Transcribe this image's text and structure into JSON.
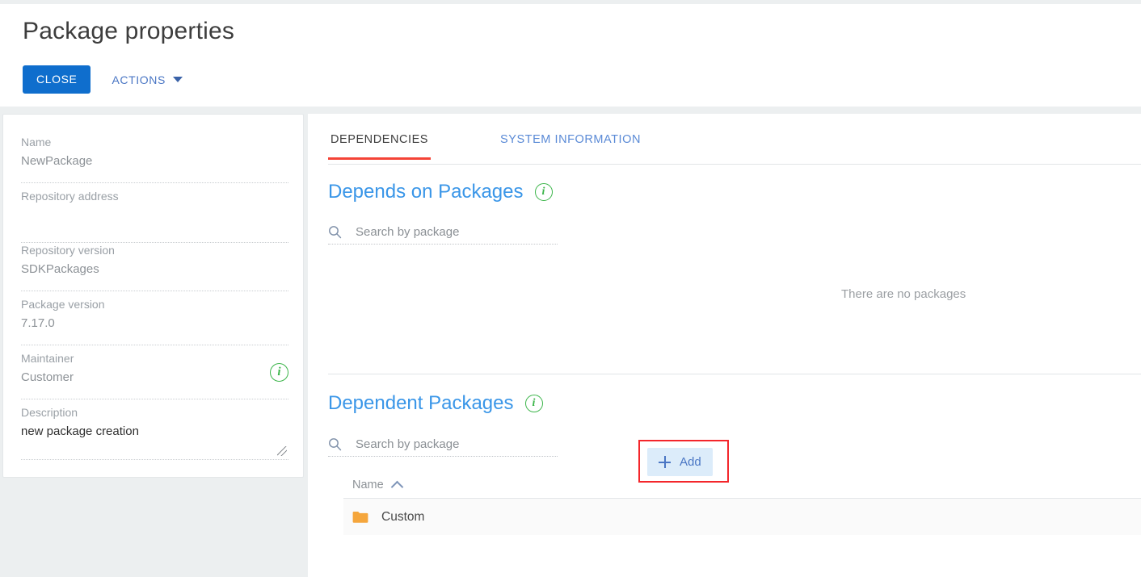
{
  "header": {
    "title": "Package properties",
    "close_label": "CLOSE",
    "actions_label": "ACTIONS"
  },
  "sidebar": {
    "fields": [
      {
        "label": "Name",
        "value": "NewPackage",
        "has_info": false,
        "dark": false
      },
      {
        "label": "Repository address",
        "value": "",
        "has_info": false,
        "dark": false
      },
      {
        "label": "Repository version",
        "value": "SDKPackages",
        "has_info": false,
        "dark": false
      },
      {
        "label": "Package version",
        "value": "7.17.0",
        "has_info": false,
        "dark": false
      },
      {
        "label": "Maintainer",
        "value": "Customer",
        "has_info": true,
        "dark": false
      },
      {
        "label": "Description",
        "value": "new package creation",
        "has_info": false,
        "dark": true
      }
    ]
  },
  "main": {
    "tabs": [
      {
        "label": "DEPENDENCIES",
        "active": true
      },
      {
        "label": "SYSTEM INFORMATION",
        "active": false
      }
    ],
    "depends_on": {
      "title": "Depends on Packages",
      "search_placeholder": "Search by package",
      "search_value": "",
      "empty_text": "There are no packages",
      "add_label": "Add"
    },
    "dependent": {
      "title": "Dependent Packages",
      "search_placeholder": "Search by package",
      "search_value": "",
      "column_name": "Name",
      "sort_direction": "asc",
      "rows": [
        {
          "name": "Custom",
          "icon": "folder-icon"
        }
      ]
    }
  },
  "icons": {
    "info": "i",
    "search": "search-icon",
    "plus": "plus-icon",
    "caret": "chevron-down-icon",
    "sort": "chevron-up-icon",
    "folder": "folder-icon",
    "resize": "resize-grip-icon"
  },
  "colors": {
    "primary_blue": "#0f6ecd",
    "link_blue": "#4a76c4",
    "heading_blue": "#3a96e8",
    "active_tab_underline": "#f44336",
    "highlight_box": "#f4262b",
    "info_green": "#3cb54a",
    "folder_orange": "#f5a63c",
    "page_bg": "#eceff0"
  }
}
